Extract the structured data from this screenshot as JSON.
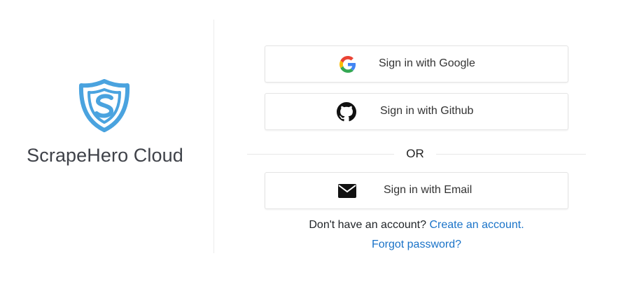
{
  "brand": {
    "name": "ScrapeHero Cloud",
    "logo_icon": "shield-s-logo-icon",
    "logo_color": "#4aa3df"
  },
  "auth": {
    "google_label": "Sign in with Google",
    "github_label": "Sign in with Github",
    "or_label": "OR",
    "email_label": "Sign in with Email"
  },
  "footer": {
    "no_account_text": "Don't have an account?",
    "create_account_link": "Create an account.",
    "forgot_password_link": "Forgot password?"
  },
  "colors": {
    "link": "#1a73c8",
    "google_blue": "#4285F4",
    "google_red": "#EA4335",
    "google_yellow": "#FBBC05",
    "google_green": "#34A853"
  }
}
